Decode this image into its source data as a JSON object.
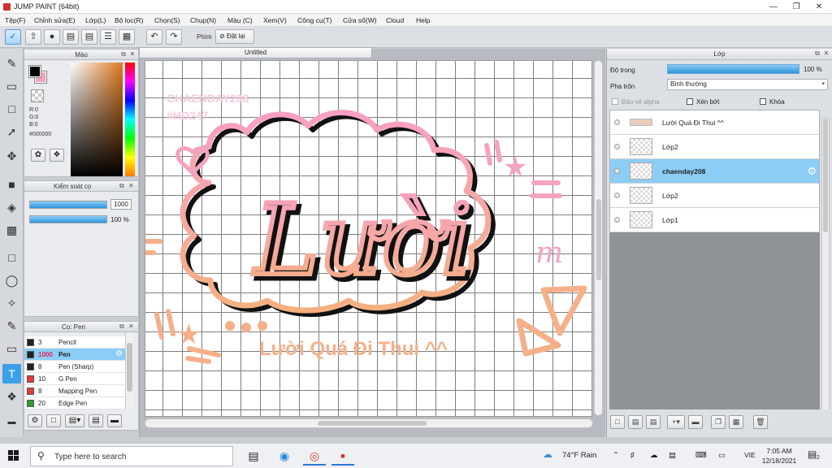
{
  "window": {
    "title": "JUMP PAINT (64bit)",
    "controls": [
      "minimize-icon",
      "restore-icon",
      "close-icon"
    ]
  },
  "menu": [
    "Tệp(F)",
    "Chỉnh sửa(E)",
    "Lớp(L)",
    "Bộ lọc(R)",
    "Chọn(S)",
    "Chụp(N)",
    "Màu (C)",
    "Xem(V)",
    "Công cụ(T)",
    "Cửa sổ(W)",
    "Cloud",
    "Help"
  ],
  "toolbar": {
    "phim_label": "Phím",
    "reset_label": "Đặt lại"
  },
  "color_panel": {
    "title": "Màu",
    "foreground": "#000000",
    "background": "#f4a3c0",
    "r": "R:0",
    "g": "G:0",
    "b": "B:0",
    "hex": "#000000"
  },
  "brush_control": {
    "title": "Kiểm soát cọ",
    "size_value": "1000",
    "size_fill": 1.0,
    "opacity_value": "100 %",
    "opacity_fill": 1.0
  },
  "pen_panel": {
    "title": "Cọ: Pen",
    "items": [
      {
        "size": "3",
        "name": "Pencil",
        "color": "#222222",
        "selected": false
      },
      {
        "size": "1000",
        "name": "Pen",
        "color": "#222222",
        "selected": true
      },
      {
        "size": "8",
        "name": "Pen (Sharp)",
        "color": "#222222",
        "selected": false
      },
      {
        "size": "10",
        "name": "G Pen",
        "color": "#e53935",
        "selected": false
      },
      {
        "size": "8",
        "name": "Mapping Pen",
        "color": "#e53935",
        "selected": false
      },
      {
        "size": "20",
        "name": "Edge Pen",
        "color": "#2e9e2e",
        "selected": false
      }
    ]
  },
  "document": {
    "tab": "Untitled"
  },
  "artwork": {
    "watermark_1": "CHAENDAY208",
    "watermark_2": "#HD247",
    "main_word": "Lười",
    "subtitle": "Lười Quá Đi Thui ^^",
    "pink": "#f4a3c0",
    "peach": "#f5b08a"
  },
  "layer_panel": {
    "title": "Lớp",
    "opacity_label": "Độ trong",
    "opacity_value": "100 %",
    "opacity_fill": 1.0,
    "blend_label": "Pha trộn",
    "blend_value": "Bình thường",
    "protect_alpha": "Bảo vệ alpha",
    "clip": "Xén bớt",
    "lock": "Khóa",
    "layers": [
      {
        "name": "Lười Quá Đi Thui ^^",
        "selected": false,
        "kind": "text"
      },
      {
        "name": "Lớp2",
        "selected": false,
        "kind": "image"
      },
      {
        "name": "chaenday208",
        "selected": true,
        "kind": "image"
      },
      {
        "name": "Lớp2",
        "selected": false,
        "kind": "image"
      },
      {
        "name": "Lớp1",
        "selected": false,
        "kind": "image"
      }
    ]
  },
  "taskbar": {
    "search_placeholder": "Type here to search",
    "weather": "74°F  Rain",
    "lang": "VIE",
    "time": "7:05 AM",
    "date": "12/18/2021",
    "notifications": "2"
  }
}
